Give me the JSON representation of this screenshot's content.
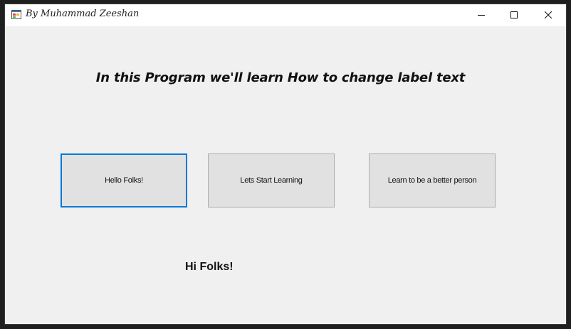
{
  "window": {
    "title": "By Muhammad Zeeshan",
    "icon": "app-form-icon",
    "controls": [
      "minimize-icon",
      "maximize-icon",
      "close-icon"
    ]
  },
  "form": {
    "heading": "In this Program we'll learn How to change label text",
    "buttons": [
      {
        "label": "Hello Folks!",
        "focused": true
      },
      {
        "label": "Lets Start Learning",
        "focused": false
      },
      {
        "label": "Learn to be a better person",
        "focused": false
      }
    ],
    "result_label": "Hi Folks!"
  },
  "colors": {
    "form_background": "#f0f0f0",
    "button_background": "#e1e1e1",
    "focus_border": "#0078d7",
    "title_bar": "#ffffff"
  }
}
